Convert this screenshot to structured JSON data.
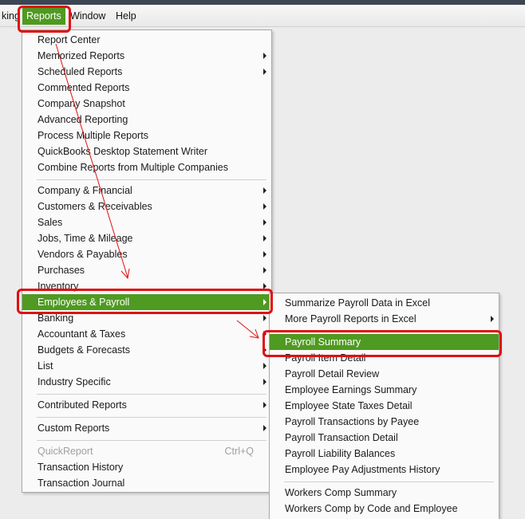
{
  "menubar": {
    "items": [
      {
        "label": "king"
      },
      {
        "label": "Reports"
      },
      {
        "label": "Window"
      },
      {
        "label": "Help"
      }
    ]
  },
  "reports_menu": {
    "group1": [
      {
        "label": "Report Center"
      },
      {
        "label": "Memorized Reports"
      },
      {
        "label": "Scheduled Reports"
      },
      {
        "label": "Commented Reports"
      },
      {
        "label": "Company Snapshot"
      },
      {
        "label": "Advanced Reporting"
      },
      {
        "label": "Process Multiple Reports"
      },
      {
        "label": "QuickBooks Desktop Statement Writer"
      },
      {
        "label": "Combine Reports from Multiple Companies"
      }
    ],
    "group2": [
      {
        "label": "Company & Financial"
      },
      {
        "label": "Customers & Receivables"
      },
      {
        "label": "Sales"
      },
      {
        "label": "Jobs, Time & Mileage"
      },
      {
        "label": "Vendors & Payables"
      },
      {
        "label": "Purchases"
      },
      {
        "label": "Inventory"
      },
      {
        "label": "Employees & Payroll"
      },
      {
        "label": "Banking"
      },
      {
        "label": "Accountant & Taxes"
      },
      {
        "label": "Budgets & Forecasts"
      },
      {
        "label": "List"
      },
      {
        "label": "Industry Specific"
      }
    ],
    "contributed": {
      "label": "Contributed Reports"
    },
    "custom": {
      "label": "Custom Reports"
    },
    "group5": [
      {
        "label": "QuickReport",
        "shortcut": "Ctrl+Q"
      },
      {
        "label": "Transaction History"
      },
      {
        "label": "Transaction Journal"
      }
    ]
  },
  "payroll_menu": {
    "group1": [
      {
        "label": "Summarize Payroll Data in Excel"
      },
      {
        "label": "More Payroll Reports in Excel"
      }
    ],
    "group2": [
      {
        "label": "Payroll Summary"
      },
      {
        "label": "Payroll Item Detail"
      },
      {
        "label": "Payroll Detail Review"
      },
      {
        "label": "Employee Earnings Summary"
      },
      {
        "label": "Employee State Taxes Detail"
      },
      {
        "label": "Payroll Transactions by Payee"
      },
      {
        "label": "Payroll Transaction Detail"
      },
      {
        "label": "Payroll Liability Balances"
      },
      {
        "label": "Employee Pay Adjustments History"
      }
    ],
    "group3": [
      {
        "label": "Workers Comp Summary"
      },
      {
        "label": "Workers Comp by Code and Employee"
      }
    ]
  },
  "colors": {
    "highlight": "#4f9a21",
    "annotation": "#e01010"
  }
}
